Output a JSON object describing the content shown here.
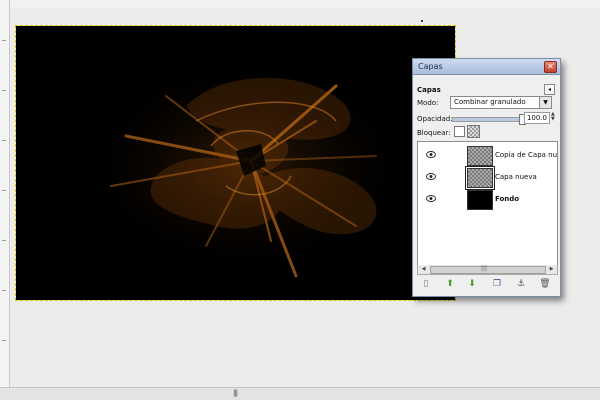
{
  "window": {
    "title": "Capas"
  },
  "panel": {
    "header": "Capas"
  },
  "mode": {
    "label": "Modo:",
    "value": "Combinar granulado"
  },
  "opacity": {
    "label": "Opacidad:",
    "value": "100.0",
    "level_percent": 100
  },
  "lock": {
    "label": "Bloquear:"
  },
  "layers": [
    {
      "name": "Copia de Capa nueva",
      "thumbnail": "transparent",
      "visible": true,
      "bold": false
    },
    {
      "name": "Capa nueva",
      "thumbnail": "transparent",
      "visible": true,
      "bold": false,
      "selected": true
    },
    {
      "name": "Fondo",
      "thumbnail": "black",
      "visible": true,
      "bold": true
    }
  ],
  "toolbar_icons": [
    "new-layer-icon",
    "raise-layer-icon",
    "lower-layer-icon",
    "duplicate-layer-icon",
    "anchor-layer-icon",
    "delete-layer-icon"
  ],
  "colors": {
    "canvas_bg": "#000000",
    "glow": "#d8791a",
    "selection_marquee": "#d9c300",
    "titlebar": "#a7bcdc"
  }
}
